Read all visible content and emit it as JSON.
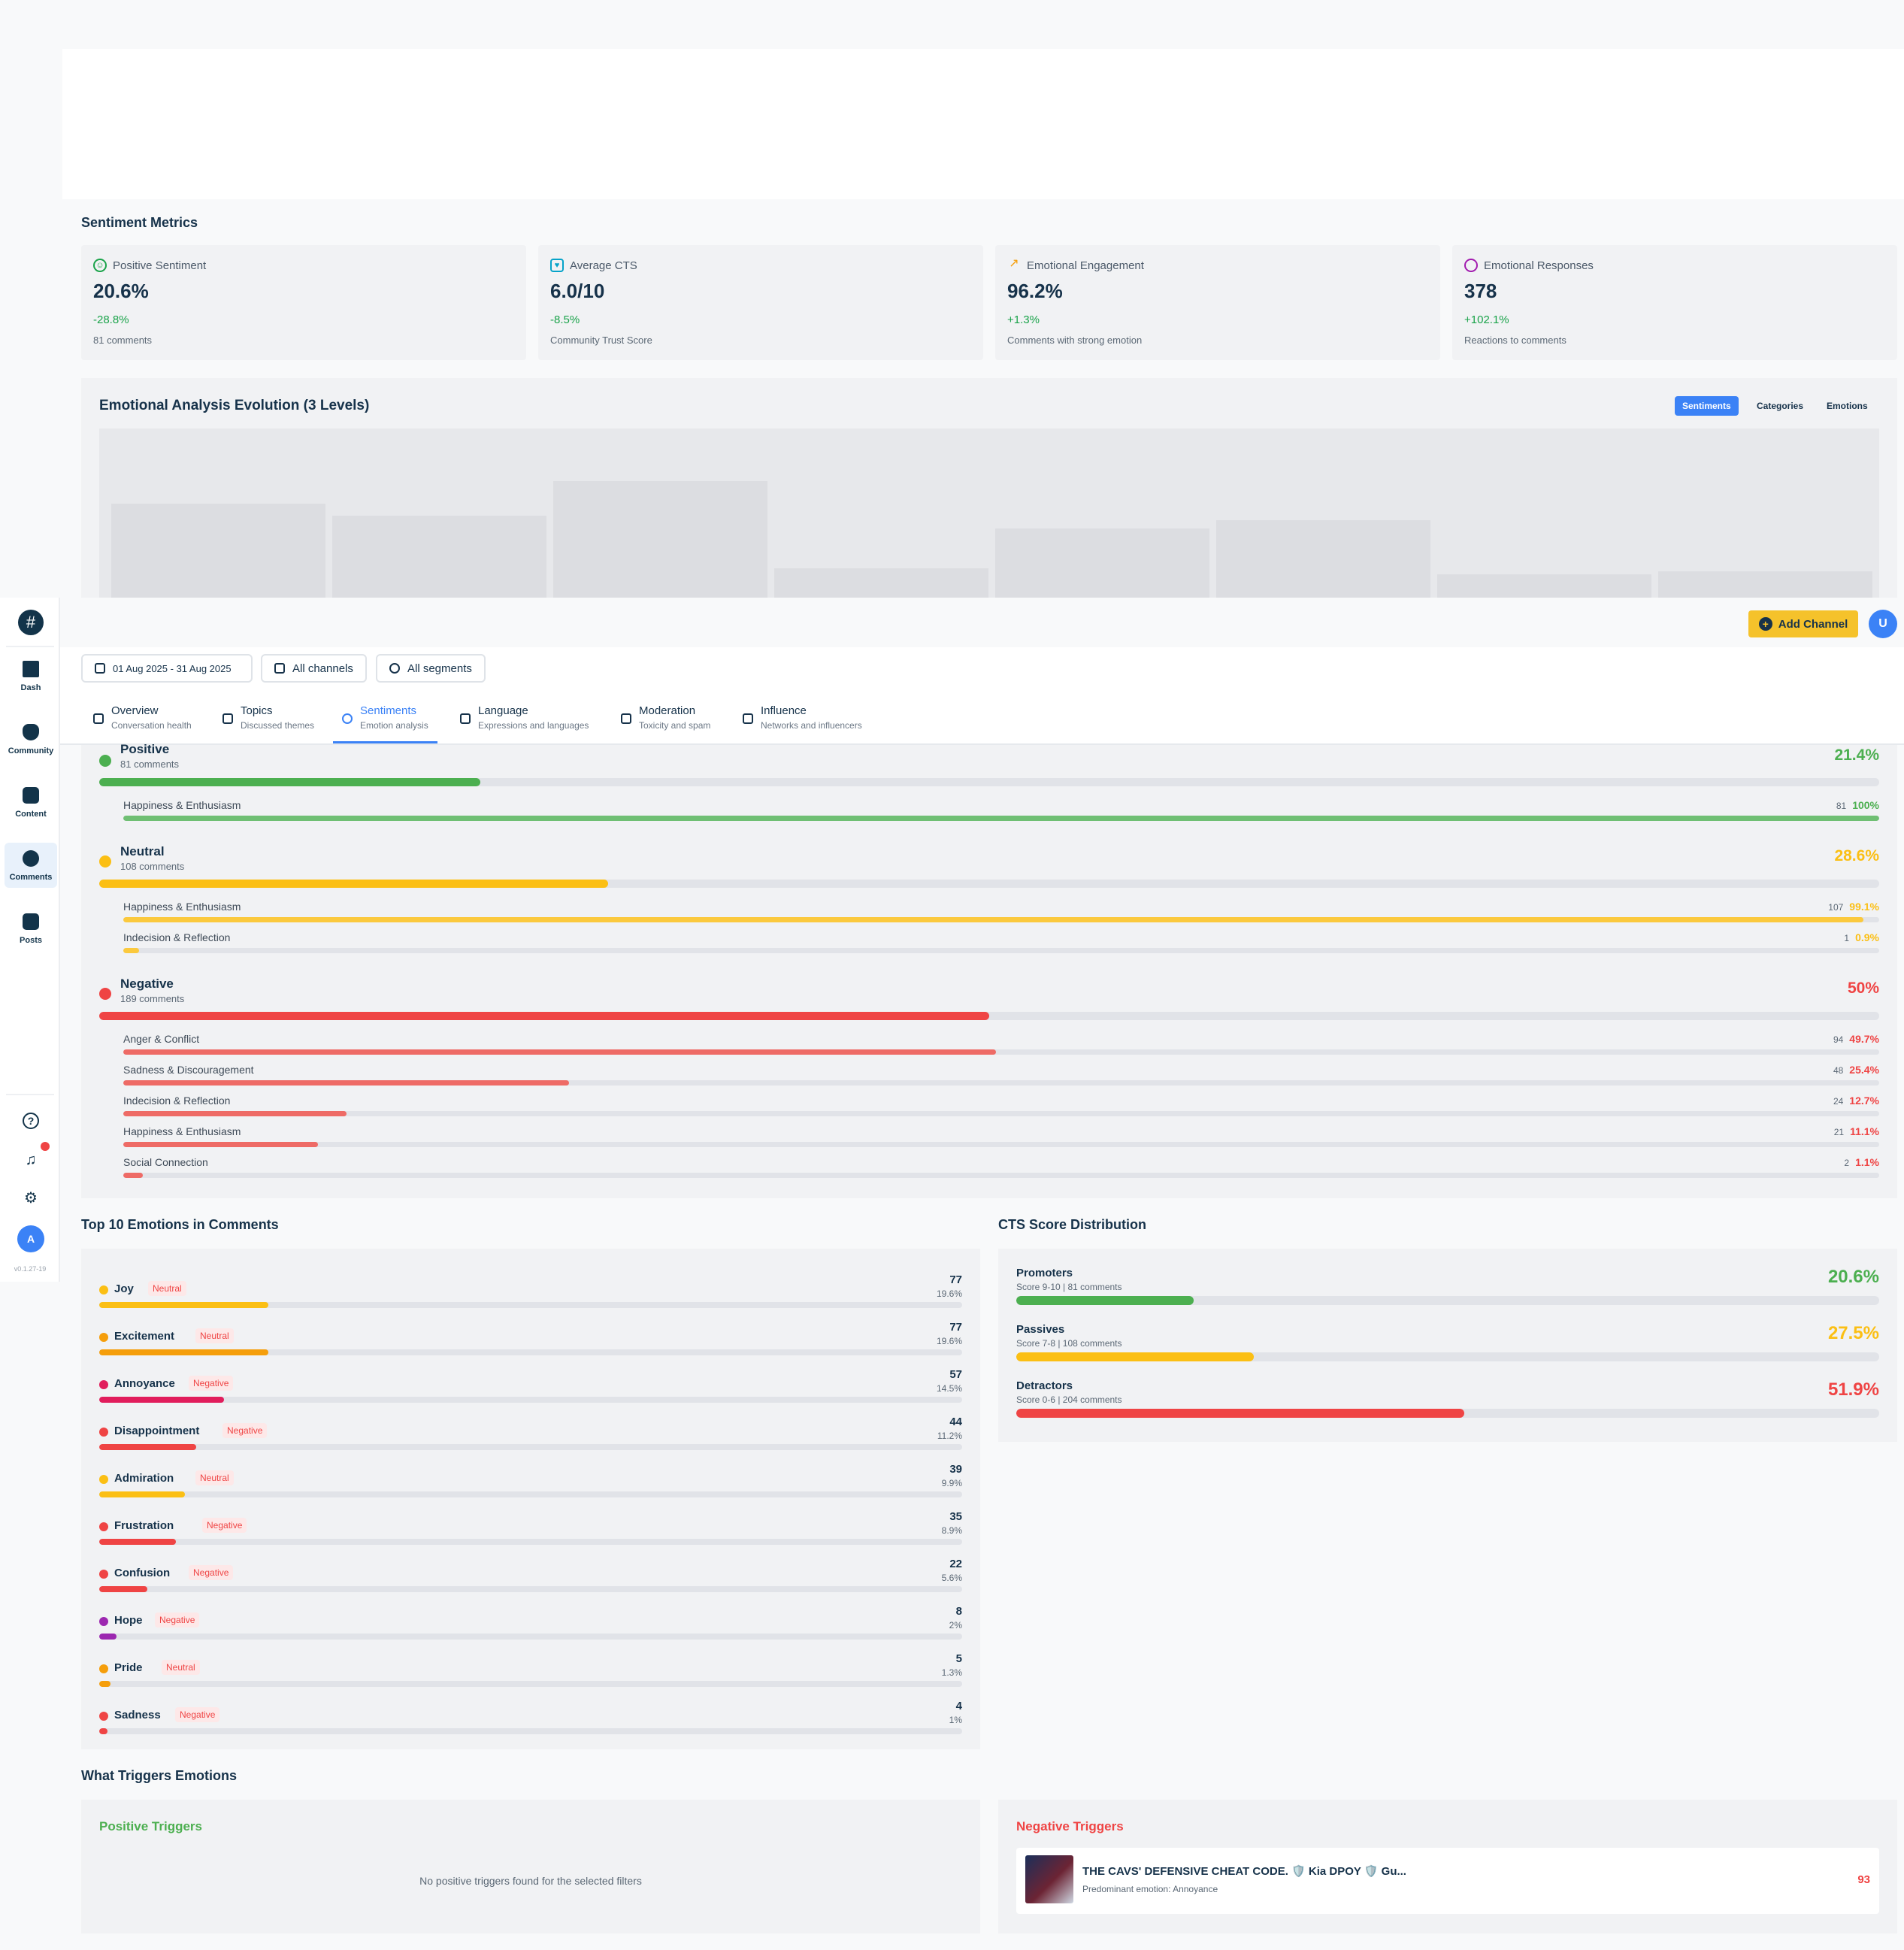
{
  "sidebar": {
    "logo": "#",
    "items": [
      {
        "label": "Dash"
      },
      {
        "label": "Community"
      },
      {
        "label": "Content"
      },
      {
        "label": "Comments"
      },
      {
        "label": "Posts"
      }
    ],
    "avatar": "A",
    "version": "v0.1.27-19"
  },
  "header": {
    "add_channel_label": "Add Channel",
    "user_avatar": "U"
  },
  "filters": {
    "date_range": "01 Aug 2025 - 31 Aug 2025",
    "channels": "All channels",
    "segments": "All segments"
  },
  "tabs": [
    {
      "label": "Overview",
      "sub": "Conversation health"
    },
    {
      "label": "Topics",
      "sub": "Discussed themes"
    },
    {
      "label": "Sentiments",
      "sub": "Emotion analysis"
    },
    {
      "label": "Language",
      "sub": "Expressions and languages"
    },
    {
      "label": "Moderation",
      "sub": "Toxicity and spam"
    },
    {
      "label": "Influence",
      "sub": "Networks and influencers"
    }
  ],
  "metrics_title": "Sentiment Metrics",
  "metrics": [
    {
      "title": "Positive Sentiment",
      "value": "20.6%",
      "change": "-28.8%",
      "sub": "81 comments",
      "icon": "smile-icon",
      "color": "#1aa34a"
    },
    {
      "title": "Average CTS",
      "value": "6.0/10",
      "change": "-8.5%",
      "sub": "Community Trust Score",
      "icon": "heart-icon",
      "color": "#06a3c9"
    },
    {
      "title": "Emotional Engagement",
      "value": "96.2%",
      "change": "+1.3%",
      "sub": "Comments with strong emotion",
      "icon": "trending-up-icon",
      "color": "#f59e0b"
    },
    {
      "title": "Emotional Responses",
      "value": "378",
      "change": "+102.1%",
      "sub": "Reactions to comments",
      "icon": "message-circle-icon",
      "color": "#a21caf"
    }
  ],
  "evolution": {
    "title": "Emotional Analysis Evolution (3 Levels)",
    "toggles": [
      "Sentiments",
      "Categories",
      "Emotions"
    ],
    "active_toggle": "Sentiments"
  },
  "sentiments": [
    {
      "name": "Positive",
      "count": "81 comments",
      "pct": "21.4%",
      "value": 21.4,
      "color": "#4caf50",
      "sub_color": "#6fbf73",
      "subs": [
        {
          "name": "Happiness & Enthusiasm",
          "n": "81",
          "pct": "100%",
          "value": 100
        }
      ]
    },
    {
      "name": "Neutral",
      "count": "108 comments",
      "pct": "28.6%",
      "value": 28.6,
      "color": "#fbbf14",
      "sub_color": "#fbc93d",
      "subs": [
        {
          "name": "Happiness & Enthusiasm",
          "n": "107",
          "pct": "99.1%",
          "value": 99.1
        },
        {
          "name": "Indecision & Reflection",
          "n": "1",
          "pct": "0.9%",
          "value": 0.9
        }
      ]
    },
    {
      "name": "Negative",
      "count": "189 comments",
      "pct": "50%",
      "value": 50,
      "color": "#ef4444",
      "sub_color": "#ee6b66",
      "subs": [
        {
          "name": "Anger & Conflict",
          "n": "94",
          "pct": "49.7%",
          "value": 49.7
        },
        {
          "name": "Sadness & Discouragement",
          "n": "48",
          "pct": "25.4%",
          "value": 25.4
        },
        {
          "name": "Indecision & Reflection",
          "n": "24",
          "pct": "12.7%",
          "value": 12.7
        },
        {
          "name": "Happiness & Enthusiasm",
          "n": "21",
          "pct": "11.1%",
          "value": 11.1
        },
        {
          "name": "Social Connection",
          "n": "2",
          "pct": "1.1%",
          "value": 1.1
        }
      ]
    }
  ],
  "top_emotions_title": "Top 10 Emotions in Comments",
  "top_emotions": [
    {
      "name": "Joy",
      "tag": "Neutral",
      "count": "77",
      "pct": "19.6%",
      "value": 19.6,
      "color": "#fbbf14"
    },
    {
      "name": "Excitement",
      "tag": "Neutral",
      "count": "77",
      "pct": "19.6%",
      "value": 19.6,
      "color": "#f59e0b"
    },
    {
      "name": "Annoyance",
      "tag": "Negative",
      "count": "57",
      "pct": "14.5%",
      "value": 14.5,
      "color": "#e11d5c"
    },
    {
      "name": "Disappointment",
      "tag": "Negative",
      "count": "44",
      "pct": "11.2%",
      "value": 11.2,
      "color": "#ef4444"
    },
    {
      "name": "Admiration",
      "tag": "Neutral",
      "count": "39",
      "pct": "9.9%",
      "value": 9.9,
      "color": "#fbbf14"
    },
    {
      "name": "Frustration",
      "tag": "Negative",
      "count": "35",
      "pct": "8.9%",
      "value": 8.9,
      "color": "#ef4444"
    },
    {
      "name": "Confusion",
      "tag": "Negative",
      "count": "22",
      "pct": "5.6%",
      "value": 5.6,
      "color": "#ef4444"
    },
    {
      "name": "Hope",
      "tag": "Negative",
      "count": "8",
      "pct": "2%",
      "value": 2,
      "color": "#9c27b0"
    },
    {
      "name": "Pride",
      "tag": "Neutral",
      "count": "5",
      "pct": "1.3%",
      "value": 1.3,
      "color": "#f59e0b"
    },
    {
      "name": "Sadness",
      "tag": "Negative",
      "count": "4",
      "pct": "1%",
      "value": 1,
      "color": "#ef4444"
    }
  ],
  "cts_title": "CTS Score Distribution",
  "cts": [
    {
      "name": "Promoters",
      "sub": "Score 9-10 | 81 comments",
      "pct": "20.6%",
      "value": 20.6,
      "color": "#4caf50"
    },
    {
      "name": "Passives",
      "sub": "Score 7-8 | 108 comments",
      "pct": "27.5%",
      "value": 27.5,
      "color": "#fbbf14"
    },
    {
      "name": "Detractors",
      "sub": "Score 0-6 | 204 comments",
      "pct": "51.9%",
      "value": 51.9,
      "color": "#ef4444"
    }
  ],
  "triggers_title": "What Triggers Emotions",
  "positive_triggers": {
    "title": "Positive Triggers",
    "empty": "No positive triggers found for the selected filters"
  },
  "negative_triggers": {
    "title": "Negative Triggers",
    "item": {
      "title": "THE CAVS' DEFENSIVE CHEAT CODE. 🛡️ Kia DPOY 🛡️ Gu...",
      "sub": "Predominant emotion: Annoyance",
      "score": "93"
    }
  },
  "colors": {
    "accent": "#3b82f6",
    "positive": "#1aa34a",
    "negative": "#ef4444",
    "neutral": "#fbbf14",
    "brand_yellow": "#f5c22b"
  }
}
